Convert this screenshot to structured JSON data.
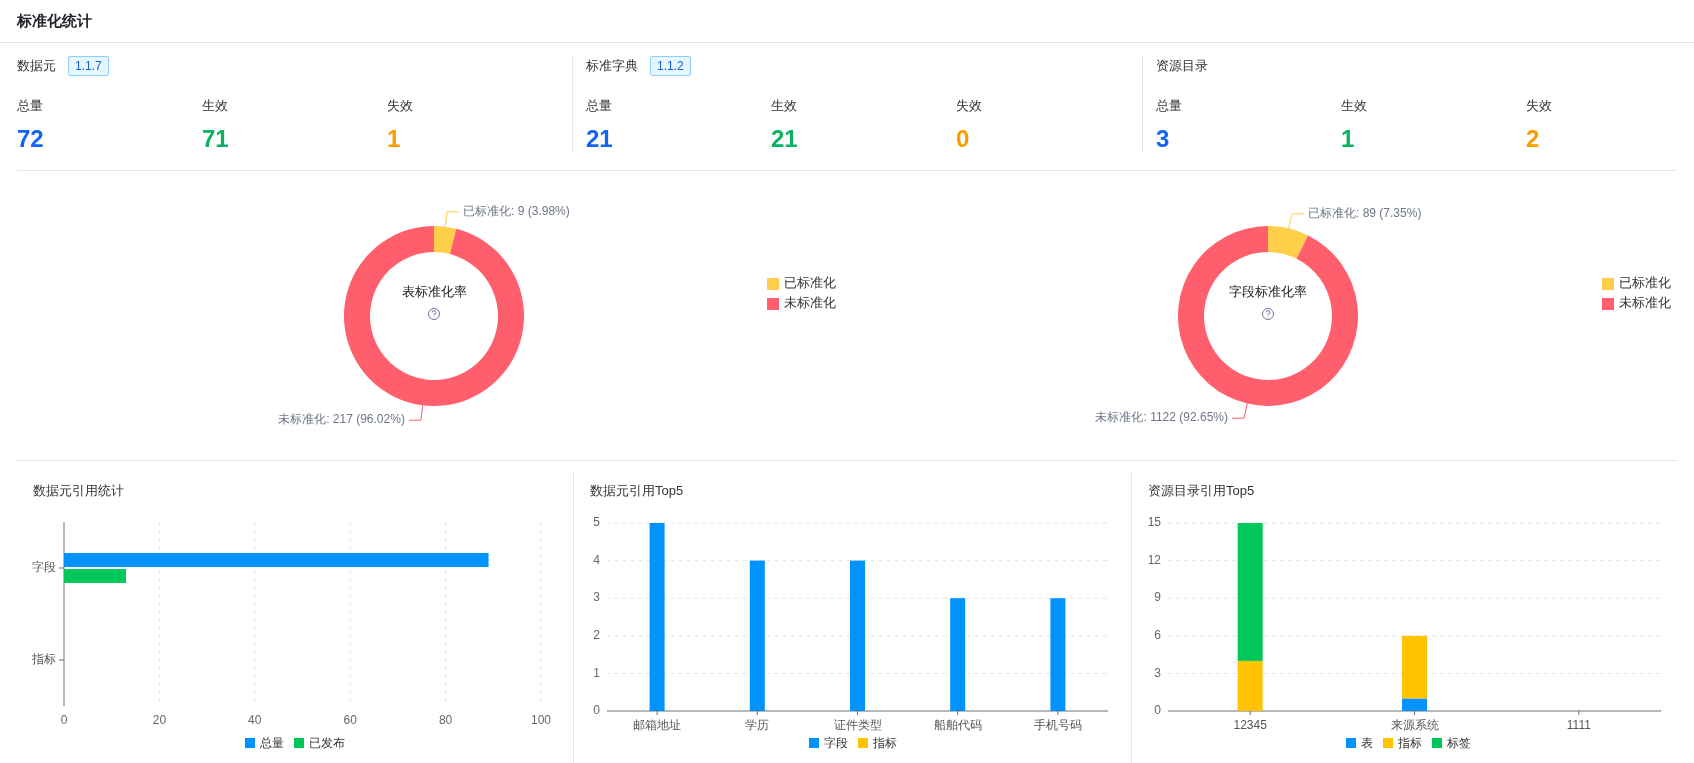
{
  "page": {
    "title": "标准化统计"
  },
  "summary": [
    {
      "title": "数据元",
      "version": "1.1.7",
      "metrics": [
        {
          "label": "总量",
          "value": "72",
          "color": "#1464f4"
        },
        {
          "label": "生效",
          "value": "71",
          "color": "#0ab35f"
        },
        {
          "label": "失效",
          "value": "1",
          "color": "#ff9a00"
        }
      ]
    },
    {
      "title": "标准字典",
      "version": "1.1.2",
      "metrics": [
        {
          "label": "总量",
          "value": "21",
          "color": "#1464f4"
        },
        {
          "label": "生效",
          "value": "21",
          "color": "#0ab35f"
        },
        {
          "label": "失效",
          "value": "0",
          "color": "#ff9a00"
        }
      ]
    },
    {
      "title": "资源目录",
      "metrics": [
        {
          "label": "总量",
          "value": "3",
          "color": "#1464f4"
        },
        {
          "label": "生效",
          "value": "1",
          "color": "#0ab35f"
        },
        {
          "label": "失效",
          "value": "2",
          "color": "#ff9a00"
        }
      ]
    }
  ],
  "standardization": [
    {
      "chart_data": {
        "type": "donut",
        "title": "表标准化率",
        "categories": [
          "已标准化",
          "未标准化"
        ],
        "values": [
          9,
          217
        ],
        "colors": [
          "#ffcf4a",
          "#ff5f6d"
        ],
        "value_labels": [
          "已标准化: 9 (3.98%)",
          "未标准化: 217 (96.02%)"
        ],
        "legend": "right"
      }
    },
    {
      "chart_data": {
        "type": "donut",
        "title": "字段标准化率",
        "categories": [
          "已标准化",
          "未标准化"
        ],
        "values": [
          89,
          1122
        ],
        "colors": [
          "#ffcf4a",
          "#ff5f6d"
        ],
        "value_labels": [
          "已标准化: 89 (7.35%)",
          "未标准化: 1122 (92.65%)"
        ],
        "legend": "right"
      }
    }
  ],
  "references": [
    {
      "chart_data": {
        "type": "bar",
        "title": "数据元引用统计",
        "orientation": "horizontal",
        "categories": [
          "字段",
          "指标"
        ],
        "series": [
          {
            "name": "总量",
            "color": "#0093ff",
            "values": [
              89,
              0
            ]
          },
          {
            "name": "已发布",
            "color": "#00c75a",
            "values": [
              13,
              0
            ]
          }
        ],
        "xlim": [
          0,
          100
        ],
        "xticks": [
          0,
          20,
          40,
          60,
          80,
          100
        ],
        "grid": true,
        "legend": "bottom"
      }
    },
    {
      "chart_data": {
        "type": "bar",
        "title": "数据元引用Top5",
        "categories": [
          "邮箱地址",
          "学历",
          "证件类型",
          "船舶代码",
          "手机号码"
        ],
        "stacked": true,
        "series": [
          {
            "name": "字段",
            "color": "#0093ff",
            "values": [
              5,
              4,
              4,
              3,
              3
            ]
          },
          {
            "name": "指标",
            "color": "#ffc300",
            "values": [
              0,
              0,
              0,
              0,
              0
            ]
          }
        ],
        "ylim": [
          0,
          5
        ],
        "yticks": [
          0,
          1,
          2,
          3,
          4,
          5
        ],
        "grid": true,
        "legend": "bottom"
      }
    },
    {
      "chart_data": {
        "type": "bar",
        "title": "资源目录引用Top5",
        "categories": [
          "12345",
          "来源系统",
          "1111"
        ],
        "stacked": true,
        "series": [
          {
            "name": "表",
            "color": "#0093ff",
            "values": [
              0,
              1,
              0
            ]
          },
          {
            "name": "指标",
            "color": "#ffc300",
            "values": [
              4,
              5,
              0
            ]
          },
          {
            "name": "标签",
            "color": "#00c75a",
            "values": [
              11,
              0,
              0
            ]
          }
        ],
        "ylim": [
          0,
          15
        ],
        "yticks": [
          0,
          3,
          6,
          9,
          12,
          15
        ],
        "grid": true,
        "legend": "bottom"
      }
    }
  ]
}
